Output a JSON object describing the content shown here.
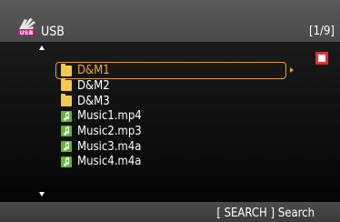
{
  "header": {
    "source_icon": "usb-hand-icon",
    "source_badge": "USB",
    "title": "USB",
    "pager": "[1/9]"
  },
  "list": {
    "items": [
      {
        "label": "D&M1",
        "type": "folder",
        "selected": true
      },
      {
        "label": "D&M2",
        "type": "folder",
        "selected": false
      },
      {
        "label": "D&M3",
        "type": "folder",
        "selected": false
      },
      {
        "label": "Music1.mp4",
        "type": "music",
        "selected": false
      },
      {
        "label": "Music2.mp3",
        "type": "music",
        "selected": false
      },
      {
        "label": "Music3.m4a",
        "type": "music",
        "selected": false
      },
      {
        "label": "Music4.m4a",
        "type": "music",
        "selected": false
      }
    ]
  },
  "status": {
    "playback_icon": "stop-icon",
    "colors": {
      "frame": "#e03030",
      "fill": "#ffffff"
    }
  },
  "footer": {
    "hint": "[ SEARCH ] Search"
  },
  "colors": {
    "selection": "#e69b2e",
    "folder": "#f7c84a",
    "music": "#5cb832"
  }
}
